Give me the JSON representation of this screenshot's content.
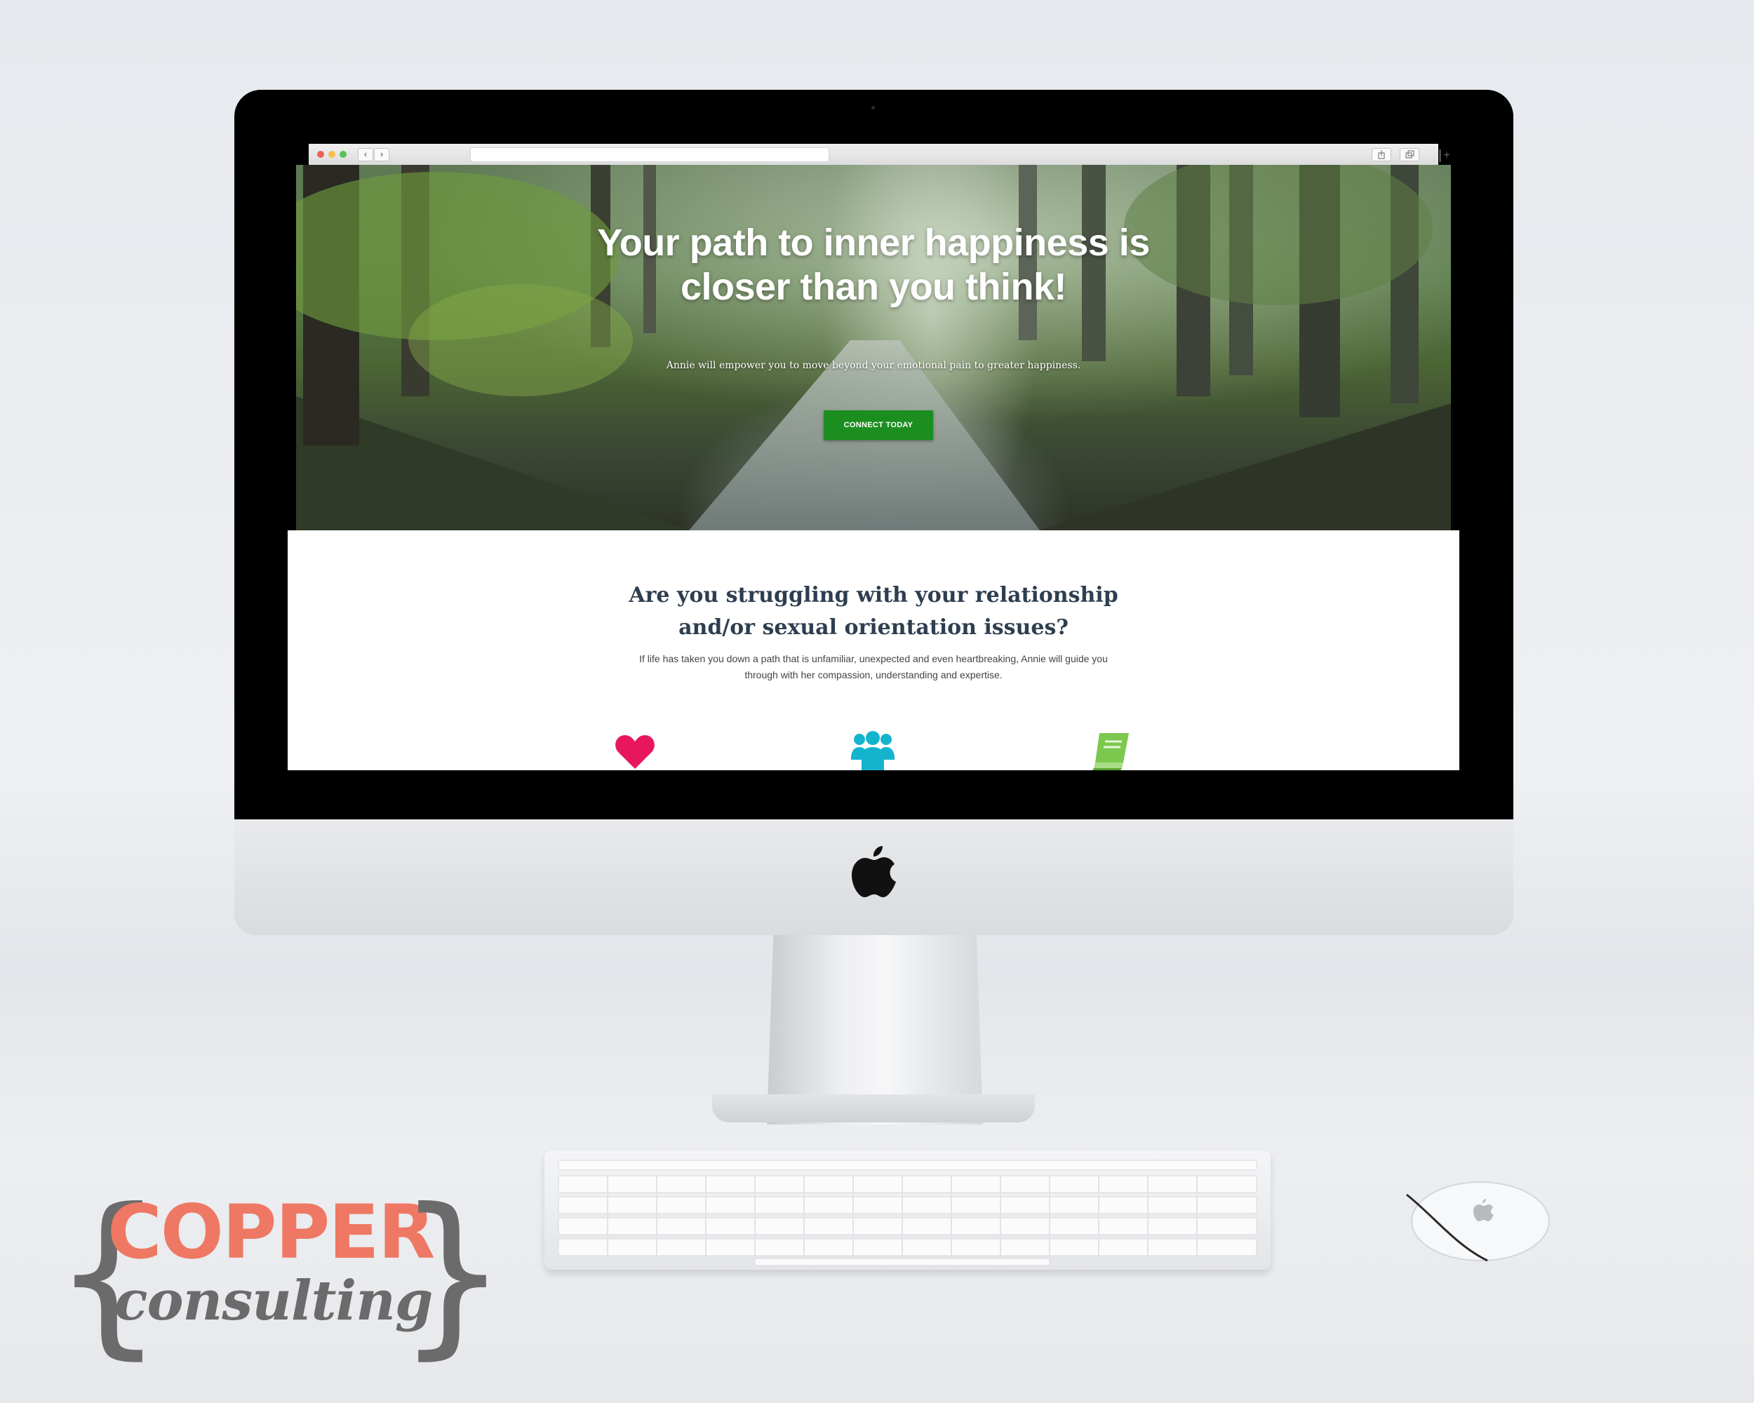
{
  "hero": {
    "title": "Your path to inner happiness is closer than you think!",
    "subtitle": "Annie will empower you to move beyond your emotional pain to greater happiness.",
    "cta_label": "CONNECT TODAY"
  },
  "section": {
    "title": "Are you struggling with your relationship and/or sexual orientation issues?",
    "body": "If life has taken you down a path that is unfamiliar, unexpected and even heartbreaking, Annie will guide you through with her compassion, understanding and expertise."
  },
  "feature_icons": [
    {
      "name": "heart-icon",
      "color": "#e8175d"
    },
    {
      "name": "group-icon",
      "color": "#14b4cf"
    },
    {
      "name": "book-icon",
      "color": "#7cc84e"
    }
  ],
  "browser": {
    "back_glyph": "‹",
    "forward_glyph": "›",
    "new_tab_glyph": "+"
  },
  "logo": {
    "brace_left": "{",
    "brace_right": "}",
    "word1": "COPPER",
    "word2": "consulting",
    "word1_color": "#ee7863",
    "word2_color": "#6b6b6b"
  },
  "colors": {
    "cta": "#1b8e1f",
    "heading": "#2e3e50"
  }
}
